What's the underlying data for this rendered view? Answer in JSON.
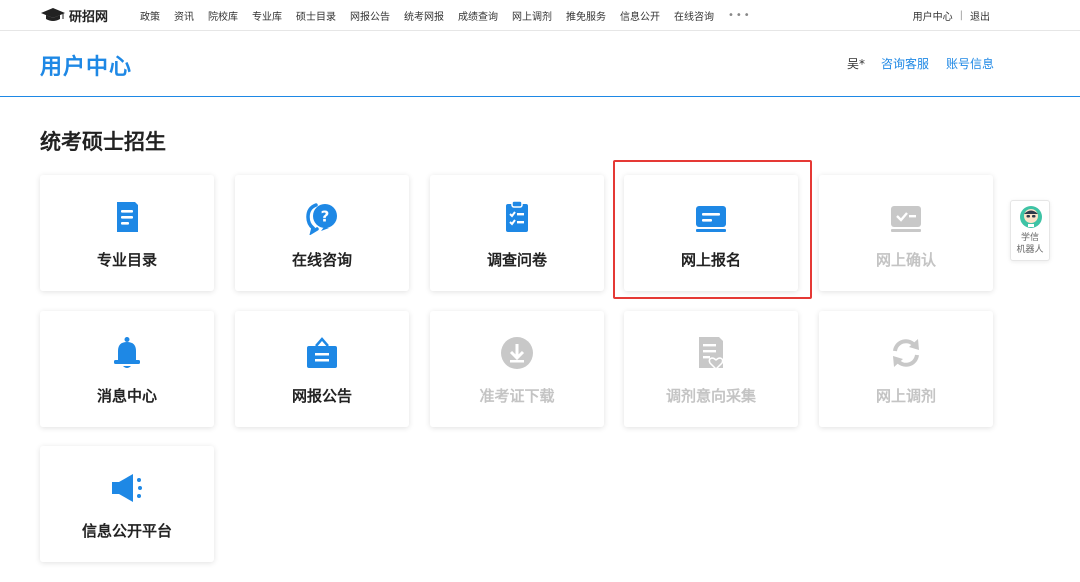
{
  "topnav": {
    "logo_text": "研招网",
    "items": [
      "政策",
      "资讯",
      "院校库",
      "专业库",
      "硕士目录",
      "网报公告",
      "统考网报",
      "成绩查询",
      "网上调剂",
      "推免服务",
      "信息公开",
      "在线咨询"
    ],
    "more": "•••",
    "user_center": "用户中心",
    "separator": "|",
    "logout": "退出"
  },
  "header": {
    "title": "用户中心",
    "user_name": "吴*",
    "service_link": "咨询客服",
    "account_link": "账号信息"
  },
  "section": {
    "title": "统考硕士招生"
  },
  "cards": [
    {
      "label": "专业目录",
      "icon": "catalog-icon",
      "enabled": true
    },
    {
      "label": "在线咨询",
      "icon": "consult-icon",
      "enabled": true
    },
    {
      "label": "调查问卷",
      "icon": "survey-icon",
      "enabled": true
    },
    {
      "label": "网上报名",
      "icon": "online-apply-icon",
      "enabled": true,
      "highlighted": true
    },
    {
      "label": "网上确认",
      "icon": "online-confirm-icon",
      "enabled": false
    },
    {
      "label": "消息中心",
      "icon": "bell-icon",
      "enabled": true
    },
    {
      "label": "网报公告",
      "icon": "announcement-icon",
      "enabled": true
    },
    {
      "label": "准考证下载",
      "icon": "download-icon",
      "enabled": false
    },
    {
      "label": "调剂意向采集",
      "icon": "adjust-intent-icon",
      "enabled": false
    },
    {
      "label": "网上调剂",
      "icon": "refresh-icon",
      "enabled": false
    },
    {
      "label": "信息公开平台",
      "icon": "megaphone-icon",
      "enabled": true
    }
  ],
  "robot": {
    "line1": "学信",
    "line2": "机器人"
  },
  "colors": {
    "primary": "#1e88e5",
    "disabled": "#c4c4c4",
    "highlight_border": "#e53935"
  }
}
